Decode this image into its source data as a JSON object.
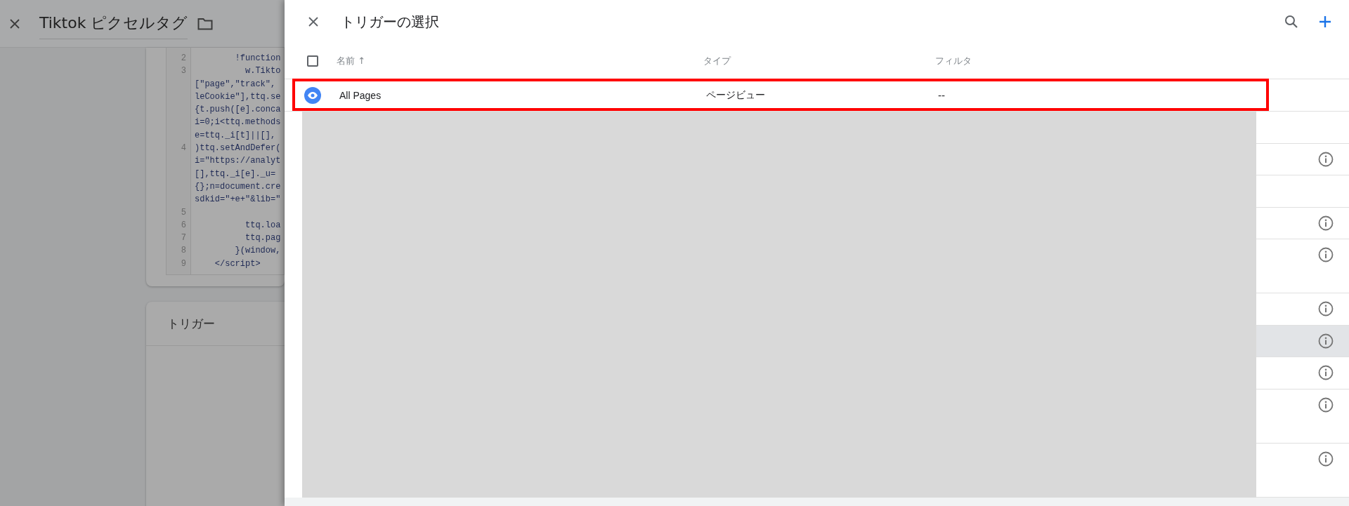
{
  "page": {
    "title": "Tiktok ピクセルタグ",
    "code_lines": [
      {
        "number": "2",
        "text": "        !function"
      },
      {
        "number": "3",
        "text": "          w.Tikto"
      },
      {
        "text": "[\"page\",\"track\","
      },
      {
        "text": "leCookie\"],ttq.se"
      },
      {
        "text": "{t.push([e].conca"
      },
      {
        "text": "i=0;i<ttq.methods"
      },
      {
        "text": "e=ttq._i[t]||[],"
      },
      {
        "number": "4",
        "text": ")ttq.setAndDefer("
      },
      {
        "text": "i=\"https://analyt"
      },
      {
        "text": "[],ttq._i[e]._u="
      },
      {
        "text": "{};n=document.cre"
      },
      {
        "text": "sdkid=\"+e+\"&lib=\""
      },
      {
        "number": "5"
      },
      {
        "number": "6",
        "text": "          ttq.loa"
      },
      {
        "number": "7",
        "text": "          ttq.pag"
      },
      {
        "number": "8",
        "text": "        }(window,"
      },
      {
        "number": "9",
        "text": "    </script>"
      }
    ],
    "trigger_card": {
      "title": "トリガー"
    }
  },
  "panel": {
    "title": "トリガーの選択",
    "columns": [
      {
        "label": "名前 ↑"
      },
      {
        "label": "タイプ"
      },
      {
        "label": "フィルタ"
      }
    ],
    "select_all_checked": false,
    "rows": [
      {
        "name": "All Pages",
        "type": "ページビュー",
        "filter": "--",
        "annotated": true
      }
    ],
    "hidden_rows": [
      {
        "tall": false,
        "info": false,
        "hovered": false
      },
      {
        "tall": false,
        "info": true,
        "hovered": false
      },
      {
        "tall": false,
        "info": false,
        "hovered": false
      },
      {
        "tall": false,
        "info": true,
        "hovered": false
      },
      {
        "tall": true,
        "info": true,
        "hovered": false
      },
      {
        "tall": false,
        "info": true,
        "hovered": false
      },
      {
        "tall": false,
        "info": true,
        "hovered": true
      },
      {
        "tall": false,
        "info": true,
        "hovered": false
      },
      {
        "tall": true,
        "info": true,
        "hovered": false
      },
      {
        "tall": true,
        "info": true,
        "hovered": false
      }
    ]
  }
}
